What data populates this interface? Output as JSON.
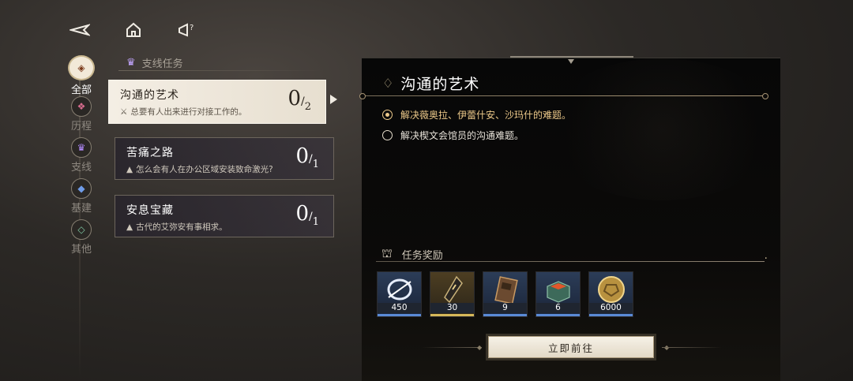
{
  "top_nav": {
    "back_icon": "back-arrow-icon",
    "home_icon": "home-icon",
    "help_icon": "help-icon"
  },
  "categories": [
    {
      "label": "全部",
      "icon": "all-icon",
      "active": true
    },
    {
      "label": "历程",
      "icon": "journey-icon",
      "active": false
    },
    {
      "label": "支线",
      "icon": "side-quest-icon",
      "active": false
    },
    {
      "label": "基建",
      "icon": "base-icon",
      "active": false
    },
    {
      "label": "其他",
      "icon": "other-icon",
      "active": false
    }
  ],
  "section": {
    "label": "支线任务",
    "icon": "side-quest-icon"
  },
  "quests": [
    {
      "title": "沟通的艺术",
      "desc": "总要有人出来进行对接工作的。",
      "progress": "0",
      "total": "2",
      "active": true
    },
    {
      "title": "苦痛之路",
      "desc": "怎么会有人在办公区域安装致命激光?",
      "progress": "0",
      "total": "1",
      "active": false
    },
    {
      "title": "安息宝藏",
      "desc": "古代的艾弥安有事相求。",
      "progress": "0",
      "total": "1",
      "active": false
    }
  ],
  "detail": {
    "title": "沟通的艺术",
    "objectives": [
      {
        "text": "解决薇奥拉、伊蕾什安、沙玛什的难题。",
        "current": true
      },
      {
        "text": "解决楔文会馆员的沟通难题。",
        "current": false
      }
    ],
    "reward_title": "任务奖励",
    "rewards": [
      {
        "qty": "450",
        "icon": "exp-ring-icon",
        "rarity": "blue"
      },
      {
        "qty": "30",
        "icon": "crystal-shard-icon",
        "rarity": "gold"
      },
      {
        "qty": "9",
        "icon": "book-icon",
        "rarity": "blue"
      },
      {
        "qty": "6",
        "icon": "ore-box-icon",
        "rarity": "blue"
      },
      {
        "qty": "6000",
        "icon": "gold-coin-icon",
        "rarity": "blue"
      }
    ],
    "go_label": "立即前往"
  },
  "colors": {
    "accent_gold": "#ecc98a",
    "reward_blue": "#5a8ad6",
    "reward_gold": "#d6b85a"
  }
}
